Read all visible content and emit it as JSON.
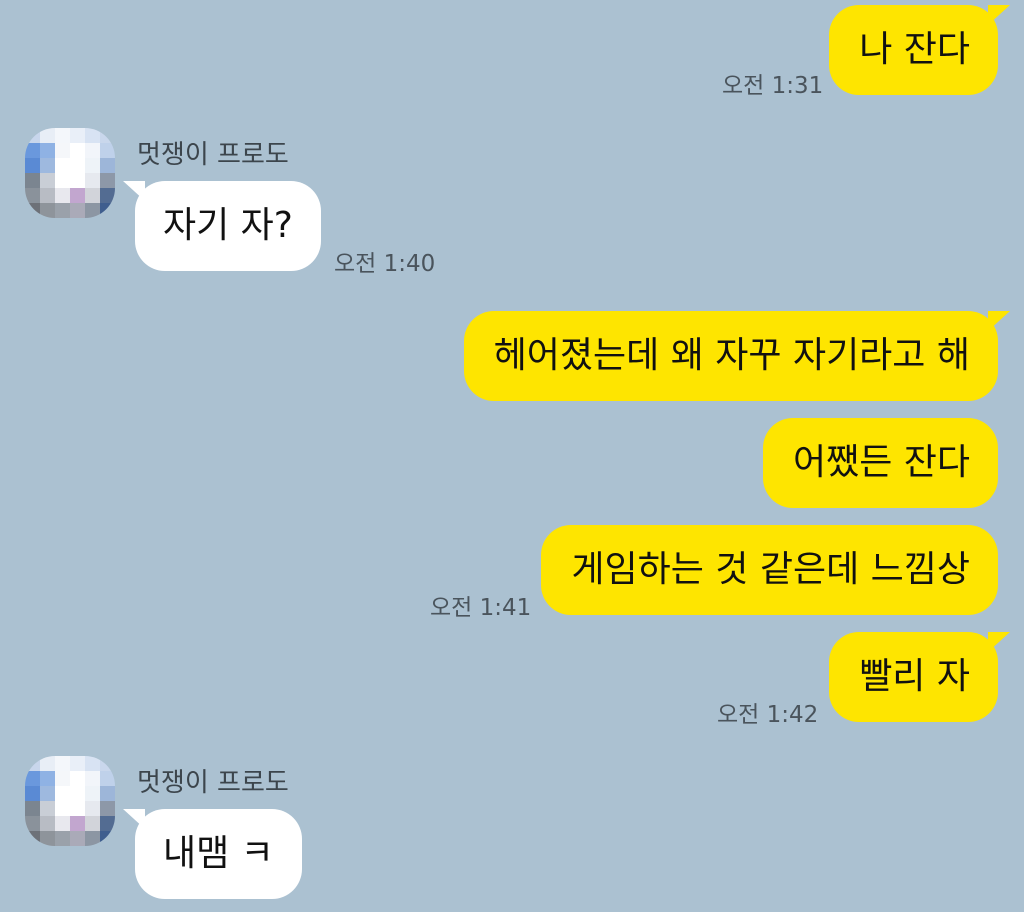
{
  "chat": {
    "colors": {
      "background": "#abc1d1",
      "my_bubble": "#fee500",
      "their_bubble": "#ffffff"
    },
    "messages": [
      {
        "from": "me",
        "text": "나 잔다",
        "time": "오전 1:31"
      },
      {
        "from": "friend",
        "sender": "멋쟁이 프로도",
        "text": "자기 자?",
        "time": "오전 1:40"
      },
      {
        "from": "me",
        "text": "헤어졌는데 왜 자꾸 자기라고 해",
        "time": ""
      },
      {
        "from": "me",
        "text": "어쨌든 잔다",
        "time": ""
      },
      {
        "from": "me",
        "text": "게임하는 것 같은데 느낌상",
        "time": "오전 1:41"
      },
      {
        "from": "me",
        "text": "빨리 자",
        "time": "오전 1:42"
      },
      {
        "from": "friend",
        "sender": "멋쟁이 프로도",
        "text": "내맴 ㅋ",
        "time": ""
      }
    ]
  }
}
